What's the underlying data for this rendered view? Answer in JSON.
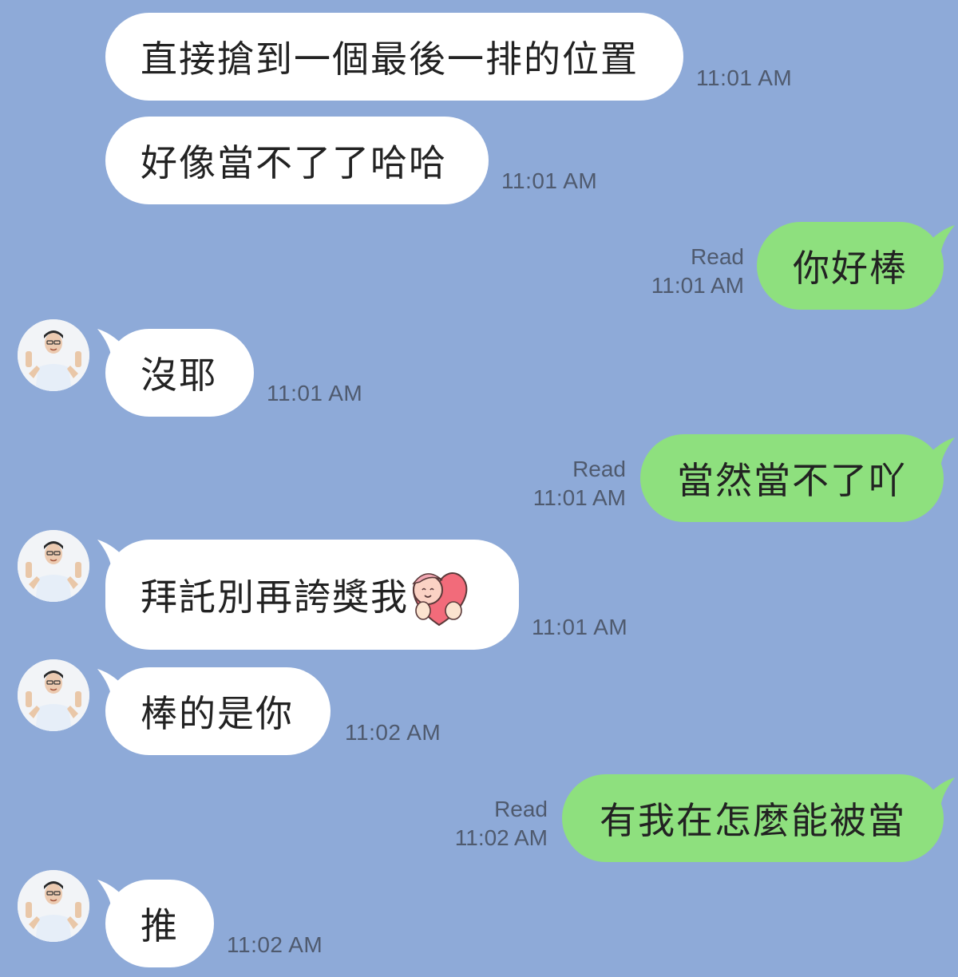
{
  "messages": [
    {
      "text": "直接搶到一個最後一排的位置",
      "time": "11:01 AM"
    },
    {
      "text": "好像當不了了哈哈",
      "time": "11:01 AM"
    },
    {
      "text": "你好棒",
      "status": "Read",
      "time": "11:01 AM"
    },
    {
      "text": "沒耶",
      "time": "11:01 AM"
    },
    {
      "text": "當然當不了吖",
      "status": "Read",
      "time": "11:01 AM"
    },
    {
      "text": "拜託別再誇獎我",
      "time": "11:01 AM",
      "sticker": "heart-hug-sticker"
    },
    {
      "text": "棒的是你",
      "time": "11:02 AM"
    },
    {
      "text": "有我在怎麼能被當",
      "status": "Read",
      "time": "11:02 AM"
    },
    {
      "text": "推",
      "time": "11:02 AM"
    }
  ],
  "colors": {
    "background": "#8eaad8",
    "incoming_bubble": "#ffffff",
    "outgoing_bubble": "#8ee07e",
    "meta_text": "#4f5a6e"
  }
}
